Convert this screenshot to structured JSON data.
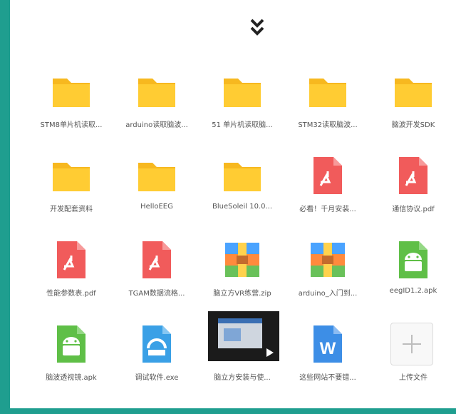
{
  "icons": {
    "collapse": "double-chevron-down-icon",
    "folder": "folder-icon",
    "pdf": "pdf-file-icon",
    "zip": "zip-archive-icon",
    "apk": "android-apk-icon",
    "exe": "installer-icon",
    "word": "word-doc-icon",
    "upload": "plus-icon"
  },
  "colors": {
    "frame": "#1f9e8f",
    "folder": "#ffcc33",
    "pdf": "#f15b5b",
    "android": "#5fbf47",
    "word": "#3d8ee6",
    "exe": "#3aa0e6"
  },
  "files": [
    {
      "name": "STM8单片机读取...",
      "type": "folder"
    },
    {
      "name": "arduino读取脑波...",
      "type": "folder"
    },
    {
      "name": "51 单片机读取脑...",
      "type": "folder"
    },
    {
      "name": "STM32读取脑波...",
      "type": "folder"
    },
    {
      "name": "脑波开发SDK",
      "type": "folder"
    },
    {
      "name": "开发配套资料",
      "type": "folder"
    },
    {
      "name": "HelloEEG",
      "type": "folder"
    },
    {
      "name": "BlueSoleil 10.0...",
      "type": "folder"
    },
    {
      "name": "必看！千月安装...",
      "type": "pdf"
    },
    {
      "name": "通信协议.pdf",
      "type": "pdf"
    },
    {
      "name": "性能参数表.pdf",
      "type": "pdf"
    },
    {
      "name": "TGAM数据流格...",
      "type": "pdf"
    },
    {
      "name": "脑立方VR练营.zip",
      "type": "zip"
    },
    {
      "name": "arduino_入门到...",
      "type": "zip"
    },
    {
      "name": "eegID1.2.apk",
      "type": "apk"
    },
    {
      "name": "脑波透视镜.apk",
      "type": "apk"
    },
    {
      "name": "调试软件.exe",
      "type": "exe"
    },
    {
      "name": "脑立方安装与使...",
      "type": "video"
    },
    {
      "name": "这些网站不要错...",
      "type": "word"
    }
  ],
  "upload": {
    "label": "上传文件"
  }
}
